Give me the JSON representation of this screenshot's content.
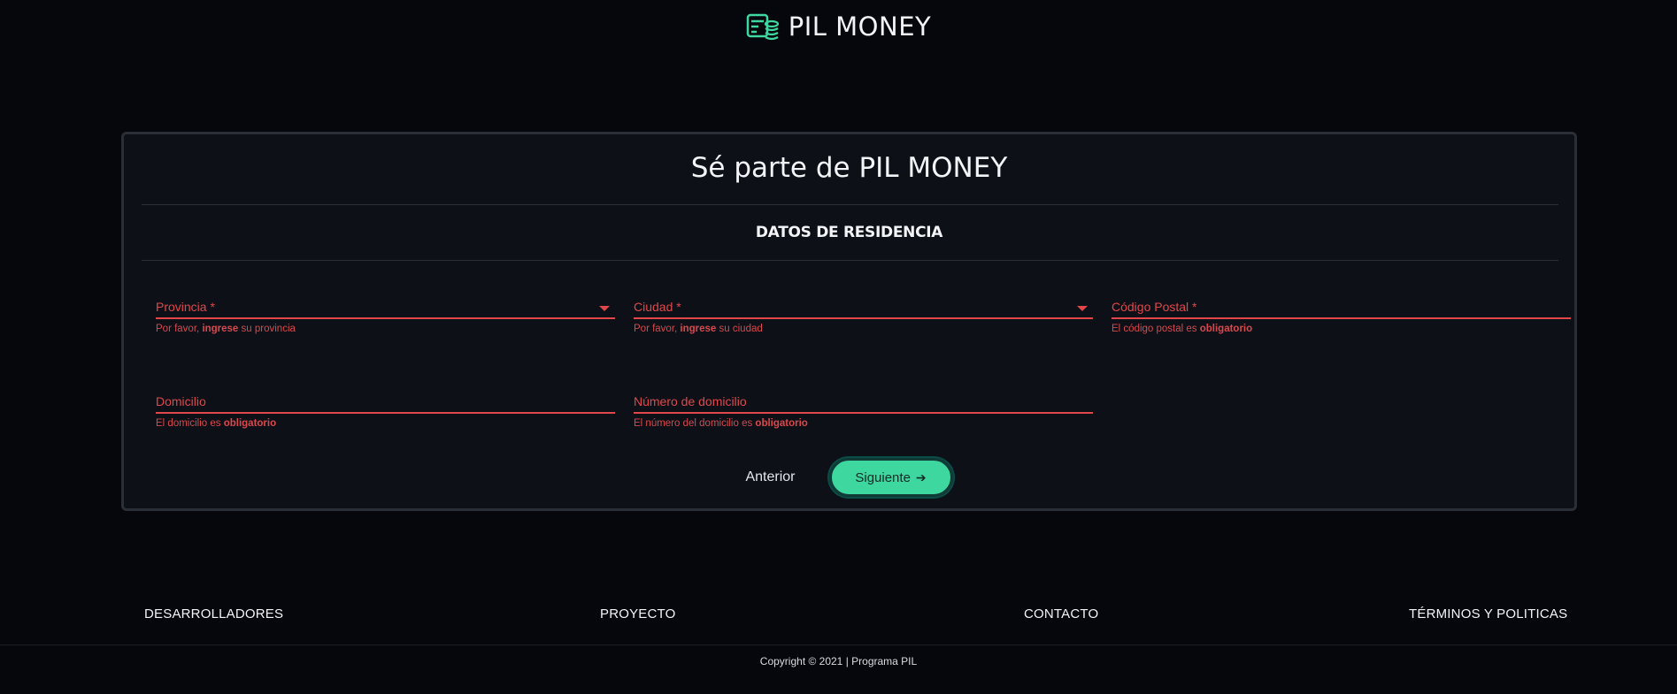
{
  "header": {
    "brand": "PIL MONEY",
    "logo_icon": "money-stack-icon"
  },
  "card": {
    "title": "Sé parte de PIL MONEY",
    "section_title": "DATOS DE RESIDENCIA"
  },
  "fields": {
    "provincia": {
      "label": "Provincia *",
      "hint_pre": "Por favor, ",
      "hint_bold": "ingrese",
      "hint_post": " su provincia"
    },
    "ciudad": {
      "label": "Ciudad *",
      "hint_pre": "Por favor, ",
      "hint_bold": "ingrese",
      "hint_post": " su ciudad"
    },
    "codigo_postal": {
      "label": "Código Postal *",
      "hint_pre": "El código postal es ",
      "hint_bold": "obligatorio",
      "hint_post": ""
    },
    "domicilio": {
      "label": "Domicilio",
      "hint_pre": "El domicilio es ",
      "hint_bold": "obligatorio",
      "hint_post": ""
    },
    "numero_domicilio": {
      "label": "Número de domicilio",
      "hint_pre": "El número del domicilio es ",
      "hint_bold": "obligatorio",
      "hint_post": ""
    }
  },
  "actions": {
    "prev_label": "Anterior",
    "next_label": "Siguiente",
    "next_icon": "arrow-right-icon"
  },
  "footer": {
    "links": [
      "DESARROLLADORES",
      "PROYECTO",
      "CONTACTO",
      "TÉRMINOS Y POLITICAS"
    ],
    "copyright": "Copyright © 2021 | Programa PIL"
  },
  "colors": {
    "background": "#05070c",
    "card": "#0d1017",
    "error": "#e0474b",
    "accent": "#3ed7a0",
    "logo": "#3ed7a0"
  }
}
